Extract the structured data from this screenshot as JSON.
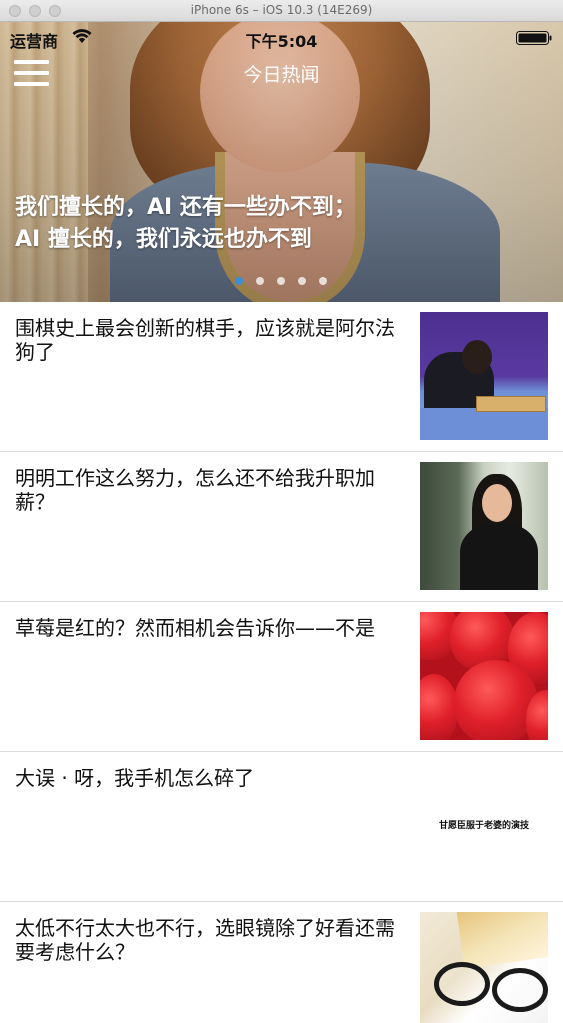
{
  "window": {
    "title": "iPhone 6s – iOS 10.3 (14E269)"
  },
  "status_bar": {
    "carrier": "运营商",
    "time": "下午5:04"
  },
  "nav": {
    "title": "今日热闻"
  },
  "banner": {
    "caption_line1": "我们擅长的，AI 还有一些办不到；",
    "caption_line2": "AI 擅长的，我们永远也办不到",
    "page_count": 5,
    "current_page": 1
  },
  "stories": [
    {
      "title": "围棋史上最会创新的棋手，应该就是阿尔法狗了",
      "thumb": "go-player"
    },
    {
      "title": "明明工作这么努力，怎么还不给我升职加薪？",
      "thumb": "woman-office"
    },
    {
      "title": "草莓是红的？然而相机会告诉你——不是",
      "thumb": "strawberries"
    },
    {
      "title": "大误 · 呀，我手机怎么碎了",
      "thumb": "text-card",
      "thumb_text": "甘愿臣服于老婆的演技"
    },
    {
      "title": "太低不行太大也不行，选眼镜除了好看还需要考虑什么？",
      "thumb": "glasses-book"
    }
  ],
  "colors": {
    "page_indicator_active": "#3a8fd8",
    "separator": "#dcdcdc",
    "text": "#111111"
  }
}
